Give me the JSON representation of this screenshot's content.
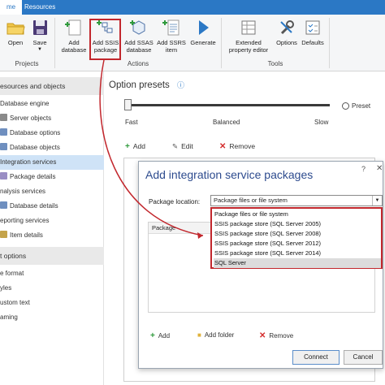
{
  "tabs": {
    "home": "me",
    "resources": "Resources"
  },
  "ribbon": {
    "open": "Open",
    "save": "Save",
    "add_database": "Add database",
    "add_ssis_package": "Add SSIS package",
    "add_ssas_database": "Add SSAS database",
    "add_ssrs_item": "Add SSRS item",
    "generate": "Generate",
    "extended_property_editor": "Extended property editor",
    "options": "Options",
    "defaults": "Defaults",
    "groups": {
      "projects": "Projects",
      "actions": "Actions",
      "tools": "Tools"
    }
  },
  "sidebar": {
    "section1": "esources and objects",
    "items1": [
      "Database engine",
      "Server objects",
      "Database options",
      "Database objects",
      "Integration services",
      "Package details",
      "nalysis services",
      "Database details",
      "eporting services",
      "Item details"
    ],
    "section2": "t options",
    "items2": [
      "e format",
      "yles",
      "ustom text",
      "aming"
    ]
  },
  "main": {
    "option_presets": "Option presets",
    "slider_labels": {
      "fast": "Fast",
      "balanced": "Balanced",
      "slow": "Slow"
    },
    "preset_label": "Preset",
    "toolbar": {
      "add": "Add",
      "edit": "Edit",
      "remove": "Remove"
    }
  },
  "dialog": {
    "title": "Add integration service packages",
    "help": "?",
    "close": "✕",
    "package_location_label": "Package location:",
    "package_location_value": "Package files or file system",
    "list_header": "Package",
    "options": [
      "Package files or file system",
      "SSIS package store (SQL Server 2005)",
      "SSIS package store (SQL Server 2008)",
      "SSIS package store (SQL Server 2012)",
      "SSIS package store (SQL Server 2014)",
      "SQL Server"
    ],
    "highlighted_index": 5,
    "toolbar": {
      "add": "Add",
      "add_folder": "Add folder",
      "remove": "Remove"
    },
    "connect": "Connect",
    "cancel": "Cancel"
  },
  "colors": {
    "accent": "#2b78c5",
    "highlight_red": "#c2272d",
    "selection": "#cfe3f7"
  }
}
